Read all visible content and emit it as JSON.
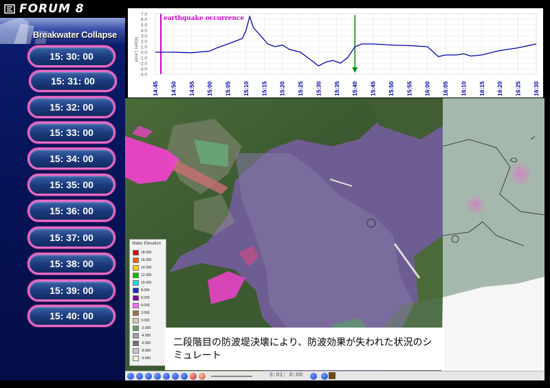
{
  "brand": {
    "logo_text": "FORUM 8"
  },
  "banner": {
    "title": "Breakwater Collapse"
  },
  "time_buttons": [
    "15: 30: 00",
    "15: 31: 00",
    "15: 32: 00",
    "15: 33: 00",
    "15: 34: 00",
    "15: 35: 00",
    "15: 36: 00",
    "15: 37: 00",
    "15: 38: 00",
    "15: 39: 00",
    "15: 40: 00"
  ],
  "chart_data": {
    "type": "line",
    "annotation": "earthquake occurrence",
    "ylabel": "Water Level",
    "ylim": [
      -4.0,
      7.0
    ],
    "yticks": [
      "7.0",
      "6.0",
      "5.0",
      "4.0",
      "3.0",
      "2.0",
      "1.0",
      "0.0",
      "-1.0",
      "-2.0",
      "-3.0",
      "-4.0"
    ],
    "xticks": [
      "14:45",
      "14:50",
      "14:55",
      "15:00",
      "15:05",
      "15:10",
      "15:15",
      "15:20",
      "15:25",
      "15:30",
      "15:35",
      "15:40",
      "15:45",
      "15:50",
      "15:55",
      "16:00",
      "16:05",
      "16:10",
      "16:15",
      "16:20",
      "16:25",
      "16:30"
    ],
    "series": [
      {
        "x": [
          "14:45",
          "14:47",
          "14:50",
          "14:55",
          "15:00",
          "15:02",
          "15:05",
          "15:07",
          "15:09",
          "15:10",
          "15:11",
          "15:12",
          "15:14",
          "15:16",
          "15:18",
          "15:20",
          "15:22",
          "15:25",
          "15:27",
          "15:30",
          "15:32",
          "15:34",
          "15:36",
          "15:38",
          "15:40",
          "15:42",
          "15:45",
          "15:50",
          "15:55",
          "16:00",
          "16:03",
          "16:05",
          "16:08",
          "16:10",
          "16:12",
          "16:15",
          "16:18",
          "16:20",
          "16:25",
          "16:30"
        ],
        "values": [
          0.0,
          0.0,
          0.0,
          -0.1,
          0.2,
          0.8,
          1.5,
          2.0,
          2.5,
          4.0,
          6.5,
          4.5,
          3.0,
          1.5,
          1.0,
          1.3,
          0.5,
          0.0,
          -1.0,
          -2.5,
          -1.8,
          -1.5,
          -2.0,
          -1.0,
          1.0,
          1.5,
          1.5,
          1.3,
          1.2,
          1.0,
          -0.8,
          -0.5,
          -0.5,
          -0.3,
          -0.7,
          -0.5,
          0.0,
          0.3,
          0.8,
          1.5
        ]
      }
    ],
    "markers": {
      "vertical_line_x": "14:45",
      "arrow_x": "15:40"
    },
    "colors": {
      "line": "#0000aa",
      "earthquake_line": "#cc00cc",
      "arrow": "#008800",
      "tick_labels": "#0000aa"
    }
  },
  "legend": {
    "title": "Water Elevation",
    "items": [
      {
        "label": "18.000",
        "color": "#e00000"
      },
      {
        "label": "16.000",
        "color": "#ff6600"
      },
      {
        "label": "14.000",
        "color": "#ffcc00"
      },
      {
        "label": "12.000",
        "color": "#00c000"
      },
      {
        "label": "10.000",
        "color": "#00e0e0"
      },
      {
        "label": "8.000",
        "color": "#1030c0"
      },
      {
        "label": "6.000",
        "color": "#8000a0"
      },
      {
        "label": "4.000",
        "color": "#ff66ff"
      },
      {
        "label": "2.000",
        "color": "#a07040"
      },
      {
        "label": "0.000",
        "color": "#d8c8b0"
      },
      {
        "label": "-2.000",
        "color": "#60a060"
      },
      {
        "label": "-4.000",
        "color": "#a0a0a0"
      },
      {
        "label": "-6.000",
        "color": "#707070"
      },
      {
        "label": "-8.000",
        "color": "#c8c8c8"
      },
      {
        "label": "-9.600",
        "color": "#f0f0d8"
      }
    ]
  },
  "caption": {
    "text": "二段階目の防波堤決壊により、防波効果が失われた状況のシミュレート"
  },
  "toolbar": {
    "time_readout": "0:01: 0:00"
  }
}
